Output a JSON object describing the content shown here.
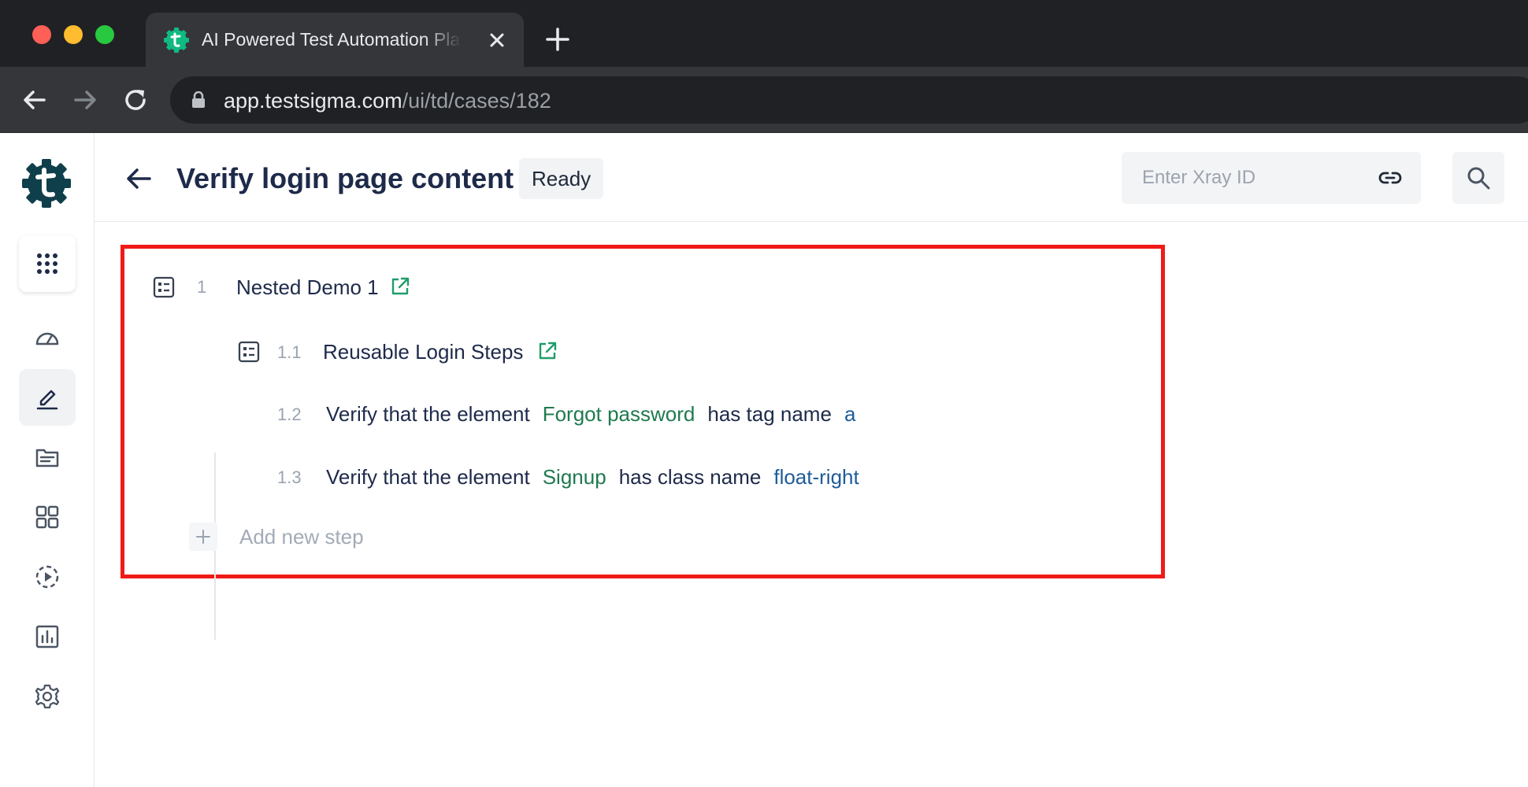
{
  "browser": {
    "tab_title": "AI Powered Test Automation Platform | Testsigma",
    "url_host": "app.testsigma.com",
    "url_path": "/ui/td/cases/182"
  },
  "sidebar": {
    "items": [
      "apps-grid-icon",
      "dashboard-icon",
      "edit-icon",
      "documents-icon",
      "widgets-icon",
      "run-icon",
      "reports-icon",
      "settings-icon"
    ]
  },
  "header": {
    "title": "Verify login page content",
    "status": "Ready",
    "xray_placeholder": "Enter Xray ID"
  },
  "steps": [
    {
      "num": "1",
      "text": "Nested Demo 1"
    },
    {
      "num": "1.1",
      "text": "Reusable Login Steps"
    },
    {
      "num": "1.2",
      "prefix": "Verify that the element",
      "element": "Forgot password",
      "middle": "has tag name",
      "value": "a"
    },
    {
      "num": "1.3",
      "prefix": "Verify that the element",
      "element": "Signup",
      "middle": "has class name",
      "value": "float-right"
    }
  ],
  "add_step_label": "Add new step",
  "colors": {
    "highlight_border": "#f01a17",
    "element_green": "#1f7a4f",
    "value_blue": "#1f5c99",
    "brand": "#0f3f4b"
  }
}
